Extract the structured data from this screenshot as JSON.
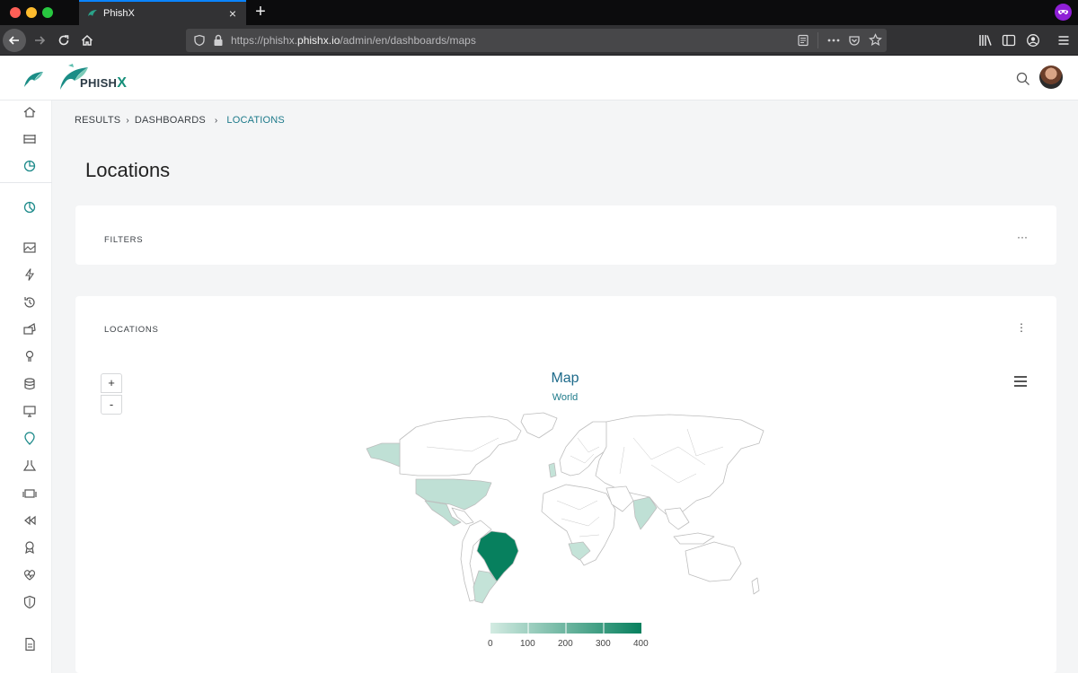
{
  "browser": {
    "tab_title": "PhishX",
    "new_tab_symbol": "+",
    "tab_close_symbol": "×",
    "url_prefix": "https://phishx.",
    "url_host": "phishx.io",
    "url_path": "/admin/en/dashboards/maps"
  },
  "header": {
    "brand_main": "PHISH",
    "brand_accent": "X",
    "brand_color": "#178f7a"
  },
  "breadcrumb": {
    "items": [
      "RESULTS",
      "DASHBOARDS",
      "LOCATIONS"
    ]
  },
  "page": {
    "title": "Locations"
  },
  "cards": {
    "filters": {
      "label": "FILTERS",
      "menu": "···"
    },
    "locations": {
      "label": "LOCATIONS",
      "menu": "⋮"
    }
  },
  "map": {
    "zoom_in": "+",
    "zoom_out": "-",
    "title": "Map",
    "subtitle": "World"
  },
  "chart_data": {
    "type": "heatmap",
    "title": "Map",
    "subtitle": "World",
    "colorscale": {
      "min_color": "#d3ebe2",
      "max_color": "#07805e"
    },
    "legend_ticks": [
      0,
      100,
      200,
      300,
      400
    ],
    "regions": [
      {
        "name": "Brazil",
        "value": 400
      },
      {
        "name": "United States",
        "value": 40
      },
      {
        "name": "Alaska",
        "value": 40
      },
      {
        "name": "Mexico",
        "value": 40
      },
      {
        "name": "Argentina",
        "value": 30
      },
      {
        "name": "India",
        "value": 40
      },
      {
        "name": "Angola",
        "value": 30
      },
      {
        "name": "Portugal",
        "value": 30
      }
    ]
  },
  "sidebar": {
    "icons": [
      "home-icon",
      "list-icon",
      "analytics-icon",
      "dashboard-icon",
      "image-icon",
      "lightning-icon",
      "history-icon",
      "campaign-icon",
      "bulb-icon",
      "database-icon",
      "monitor-icon",
      "location-icon",
      "flask-icon",
      "gallery-icon",
      "rewind-icon",
      "award-icon",
      "heartbeat-icon",
      "shield-icon",
      "document-icon"
    ]
  }
}
